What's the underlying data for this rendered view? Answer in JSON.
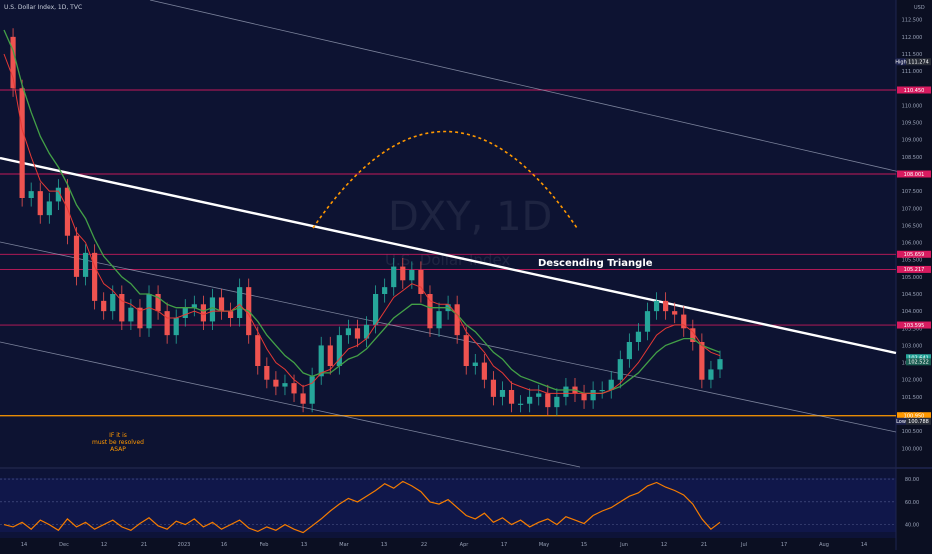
{
  "header": {
    "symbol_line": "U.S. Dollar Index, 1D, TVC",
    "currency": "USD"
  },
  "watermark": {
    "symbol": "DXY, 1D",
    "name": "U.S. Dollar Index"
  },
  "annotations": {
    "pattern_label": "Descending Triangle",
    "note_line1": "IF it is",
    "note_line2": "must be resolved",
    "note_line3": "ASAP"
  },
  "chart_data": [
    {
      "type": "candlestick",
      "title": "",
      "xlabel": "",
      "ylabel": "",
      "ylim": [
        99.6,
        112.9
      ],
      "y_ticks": [
        "112.500",
        "112.000",
        "111.500",
        "111.000",
        "110.500",
        "110.000",
        "109.500",
        "109.000",
        "108.500",
        "108.000",
        "107.500",
        "107.000",
        "106.500",
        "106.000",
        "105.500",
        "105.000",
        "104.500",
        "104.000",
        "103.500",
        "103.000",
        "102.500",
        "102.000",
        "101.500",
        "101.000",
        "100.500",
        "100.000"
      ],
      "x_ticks": [
        "14",
        "Dec",
        "12",
        "21",
        "2023",
        "16",
        "Feb",
        "13",
        "Mar",
        "13",
        "22",
        "Apr",
        "17",
        "May",
        "15",
        "Jun",
        "12",
        "21",
        "Jul",
        "17",
        "Aug",
        "14"
      ],
      "close_series": [
        112.0,
        110.5,
        107.3,
        107.5,
        106.8,
        107.2,
        107.6,
        106.2,
        105.0,
        105.7,
        104.3,
        104.0,
        104.5,
        103.7,
        104.1,
        103.5,
        104.5,
        104.0,
        103.3,
        103.8,
        104.1,
        104.2,
        103.7,
        104.4,
        104.0,
        103.8,
        104.7,
        103.3,
        102.4,
        102.0,
        101.8,
        101.9,
        101.6,
        101.3,
        102.1,
        103.0,
        102.4,
        103.3,
        103.5,
        103.2,
        103.6,
        104.5,
        104.7,
        105.3,
        104.9,
        105.2,
        104.5,
        103.5,
        104.0,
        104.2,
        103.3,
        102.4,
        102.5,
        102.0,
        101.5,
        101.7,
        101.3,
        101.3,
        101.5,
        101.6,
        101.2,
        101.5,
        101.8,
        101.6,
        101.4,
        101.7,
        101.7,
        102.0,
        102.6,
        103.1,
        103.4,
        104.0,
        104.3,
        104.0,
        103.9,
        103.5,
        103.1,
        102.0,
        102.3,
        102.6
      ],
      "ema_fast": [
        111.5,
        110.8,
        109.3,
        108.5,
        107.8,
        107.5,
        107.5,
        107.0,
        106.3,
        106.0,
        105.3,
        104.8,
        104.6,
        104.3,
        104.2,
        104.0,
        104.1,
        104.0,
        103.8,
        103.8,
        103.9,
        104.0,
        103.9,
        104.0,
        104.0,
        104.0,
        104.2,
        103.9,
        103.4,
        102.9,
        102.5,
        102.3,
        102.0,
        101.8,
        101.9,
        102.2,
        102.3,
        102.6,
        102.9,
        103.0,
        103.2,
        103.6,
        104.0,
        104.4,
        104.6,
        104.8,
        104.7,
        104.3,
        104.2,
        104.2,
        103.9,
        103.4,
        103.1,
        102.8,
        102.4,
        102.2,
        101.9,
        101.8,
        101.7,
        101.7,
        101.6,
        101.6,
        101.6,
        101.6,
        101.6,
        101.6,
        101.6,
        101.7,
        101.9,
        102.2,
        102.5,
        102.9,
        103.3,
        103.5,
        103.6,
        103.6,
        103.4,
        103.0,
        102.8,
        102.7
      ],
      "ema_slow": [
        112.2,
        111.6,
        110.6,
        109.8,
        109.1,
        108.6,
        108.2,
        107.7,
        107.1,
        106.7,
        106.1,
        105.6,
        105.3,
        105.0,
        104.8,
        104.5,
        104.5,
        104.4,
        104.2,
        104.1,
        104.1,
        104.1,
        104.0,
        104.1,
        104.0,
        104.0,
        104.1,
        104.0,
        103.7,
        103.3,
        103.0,
        102.7,
        102.5,
        102.2,
        102.1,
        102.2,
        102.2,
        102.4,
        102.6,
        102.7,
        102.9,
        103.2,
        103.5,
        103.8,
        104.0,
        104.2,
        104.2,
        104.1,
        104.1,
        104.1,
        103.9,
        103.6,
        103.4,
        103.1,
        102.8,
        102.6,
        102.3,
        102.1,
        102.0,
        101.9,
        101.8,
        101.7,
        101.7,
        101.7,
        101.6,
        101.6,
        101.6,
        101.7,
        101.8,
        102.0,
        102.2,
        102.5,
        102.8,
        103.0,
        103.1,
        103.2,
        103.2,
        103.0,
        102.9,
        102.8
      ],
      "horizontal_levels": [
        {
          "label": "110.450",
          "value": 110.45,
          "color": "#d81b60"
        },
        {
          "label": "108.001",
          "value": 108.0,
          "color": "#d81b60"
        },
        {
          "label": "105.659",
          "value": 105.659,
          "color": "#d81b60"
        },
        {
          "label": "105.217",
          "value": 105.217,
          "color": "#d81b60"
        },
        {
          "label": "103.595",
          "value": 103.595,
          "color": "#d81b60"
        },
        {
          "label": "100.950",
          "value": 100.95,
          "color": "#ff9800"
        }
      ],
      "axis_tags": [
        {
          "label": "High",
          "text": "111.274",
          "value": 111.274,
          "color": "#2a2e39"
        },
        {
          "label": "",
          "text": "102.641",
          "value": 102.641,
          "color": "#26a69a"
        },
        {
          "label": "",
          "text": "102.522",
          "value": 102.522,
          "color": "#1b5e52"
        },
        {
          "label": "Low",
          "text": "100.788",
          "value": 100.788,
          "color": "#2a2e39"
        }
      ],
      "colors": {
        "up": "#26a69a",
        "down": "#ef5350",
        "ema_fast": "#e53935",
        "ema_slow": "#43a047",
        "trendline": "#ffffff",
        "arc": "#ff9800"
      },
      "grid": false
    },
    {
      "type": "line",
      "title": "",
      "ylim": [
        30,
        88
      ],
      "y_ticks": [
        "80.00",
        "60.00",
        "40.00"
      ],
      "values": [
        40,
        38,
        42,
        36,
        44,
        40,
        35,
        45,
        38,
        42,
        36,
        40,
        44,
        38,
        35,
        41,
        46,
        39,
        36,
        43,
        40,
        45,
        38,
        42,
        36,
        40,
        44,
        37,
        34,
        38,
        35,
        40,
        36,
        33,
        39,
        45,
        52,
        58,
        63,
        60,
        65,
        70,
        76,
        72,
        78,
        74,
        69,
        60,
        58,
        62,
        55,
        48,
        45,
        50,
        42,
        46,
        40,
        44,
        38,
        42,
        45,
        40,
        47,
        44,
        41,
        48,
        52,
        55,
        60,
        65,
        68,
        74,
        77,
        73,
        70,
        66,
        58,
        45,
        36,
        42
      ],
      "color": "#f57c00",
      "grid": false
    }
  ]
}
